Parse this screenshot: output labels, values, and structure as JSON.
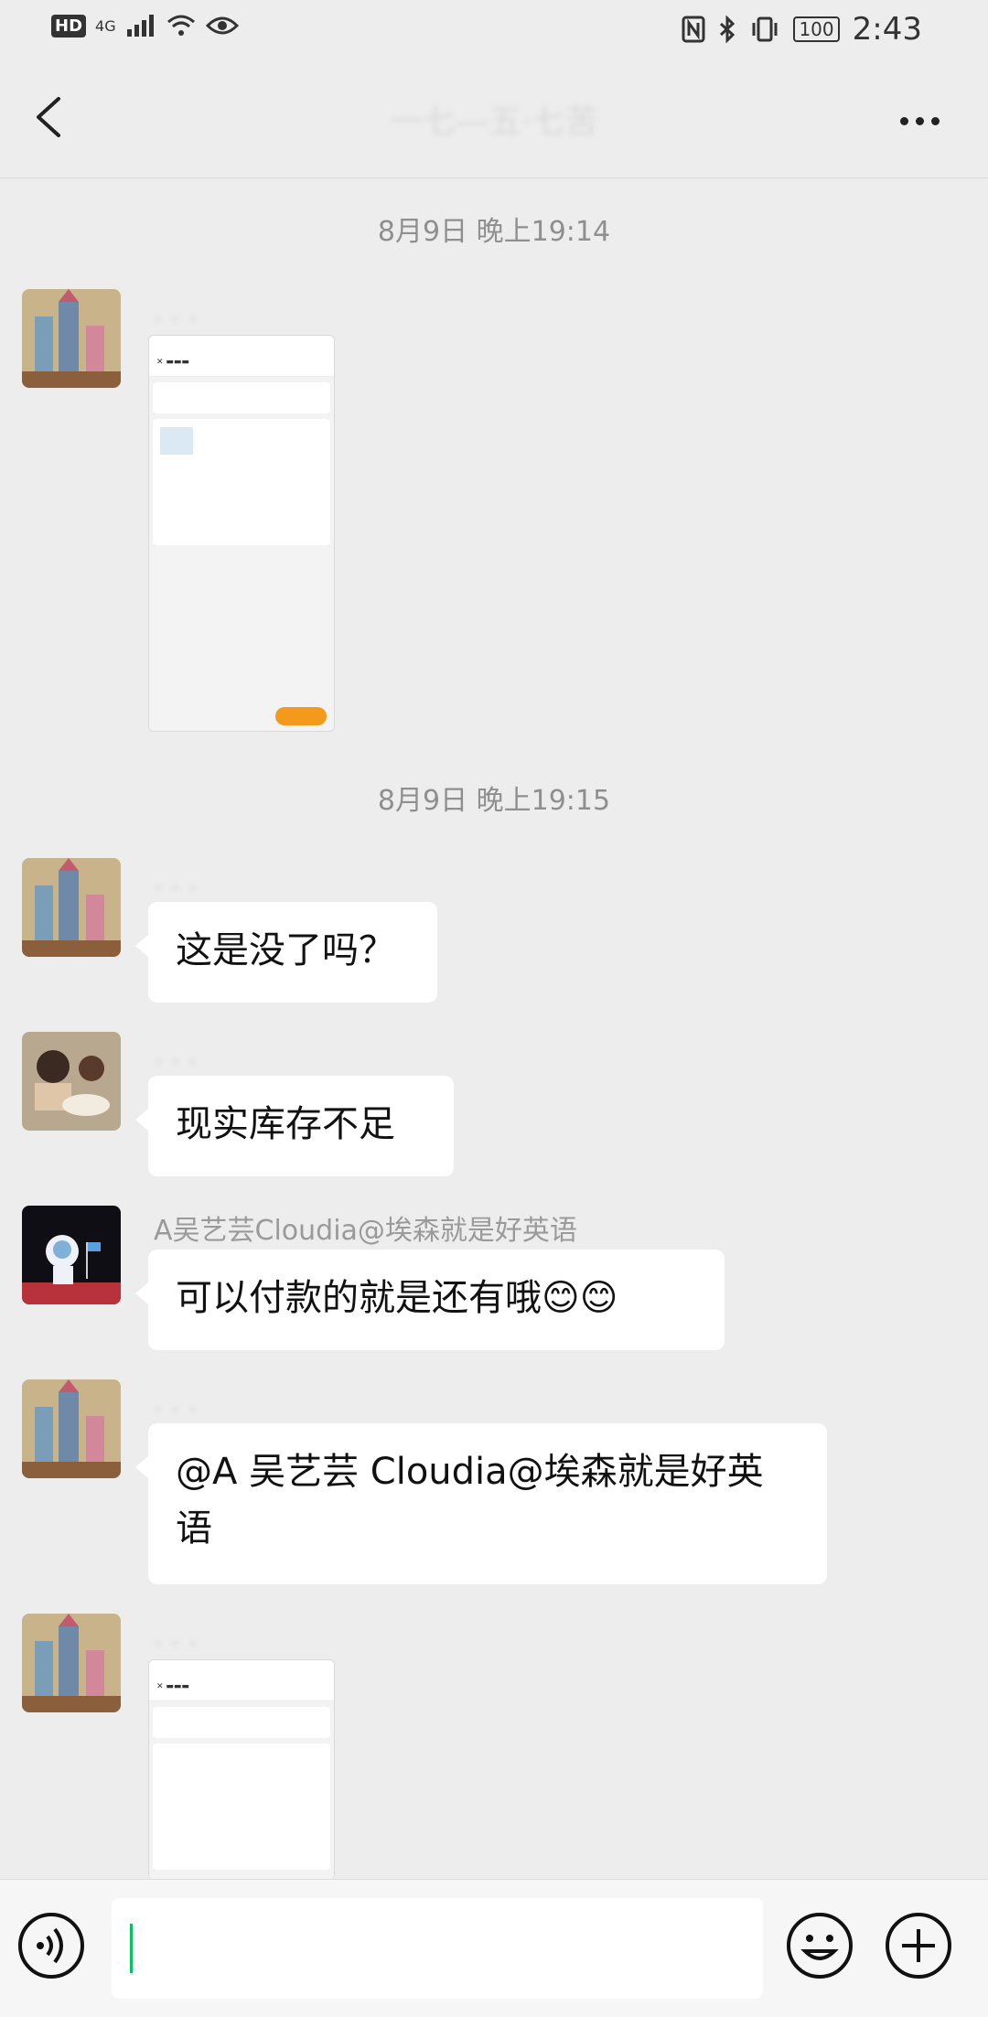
{
  "status_bar": {
    "hd": "HD",
    "network": "4G",
    "battery": "100",
    "time": "2:43"
  },
  "header": {
    "title": "一七—五·七苦"
  },
  "messages": {
    "ts1": "8月9日 晚上19:14",
    "ts2": "8月9日 晚上19:15",
    "msg1": "这是没了吗？",
    "msg2": "现实库存不足",
    "sender3": "A吴艺芸Cloudia@埃森就是好英语",
    "msg3": "可以付款的就是还有哦😊😊",
    "msg4": "@A 吴艺芸 Cloudia@埃森就是好英语"
  },
  "icons": {
    "back": "back-arrow-icon",
    "more": "more-dots-icon",
    "voice": "voice-icon",
    "emoji": "emoji-icon",
    "plus": "plus-icon"
  }
}
